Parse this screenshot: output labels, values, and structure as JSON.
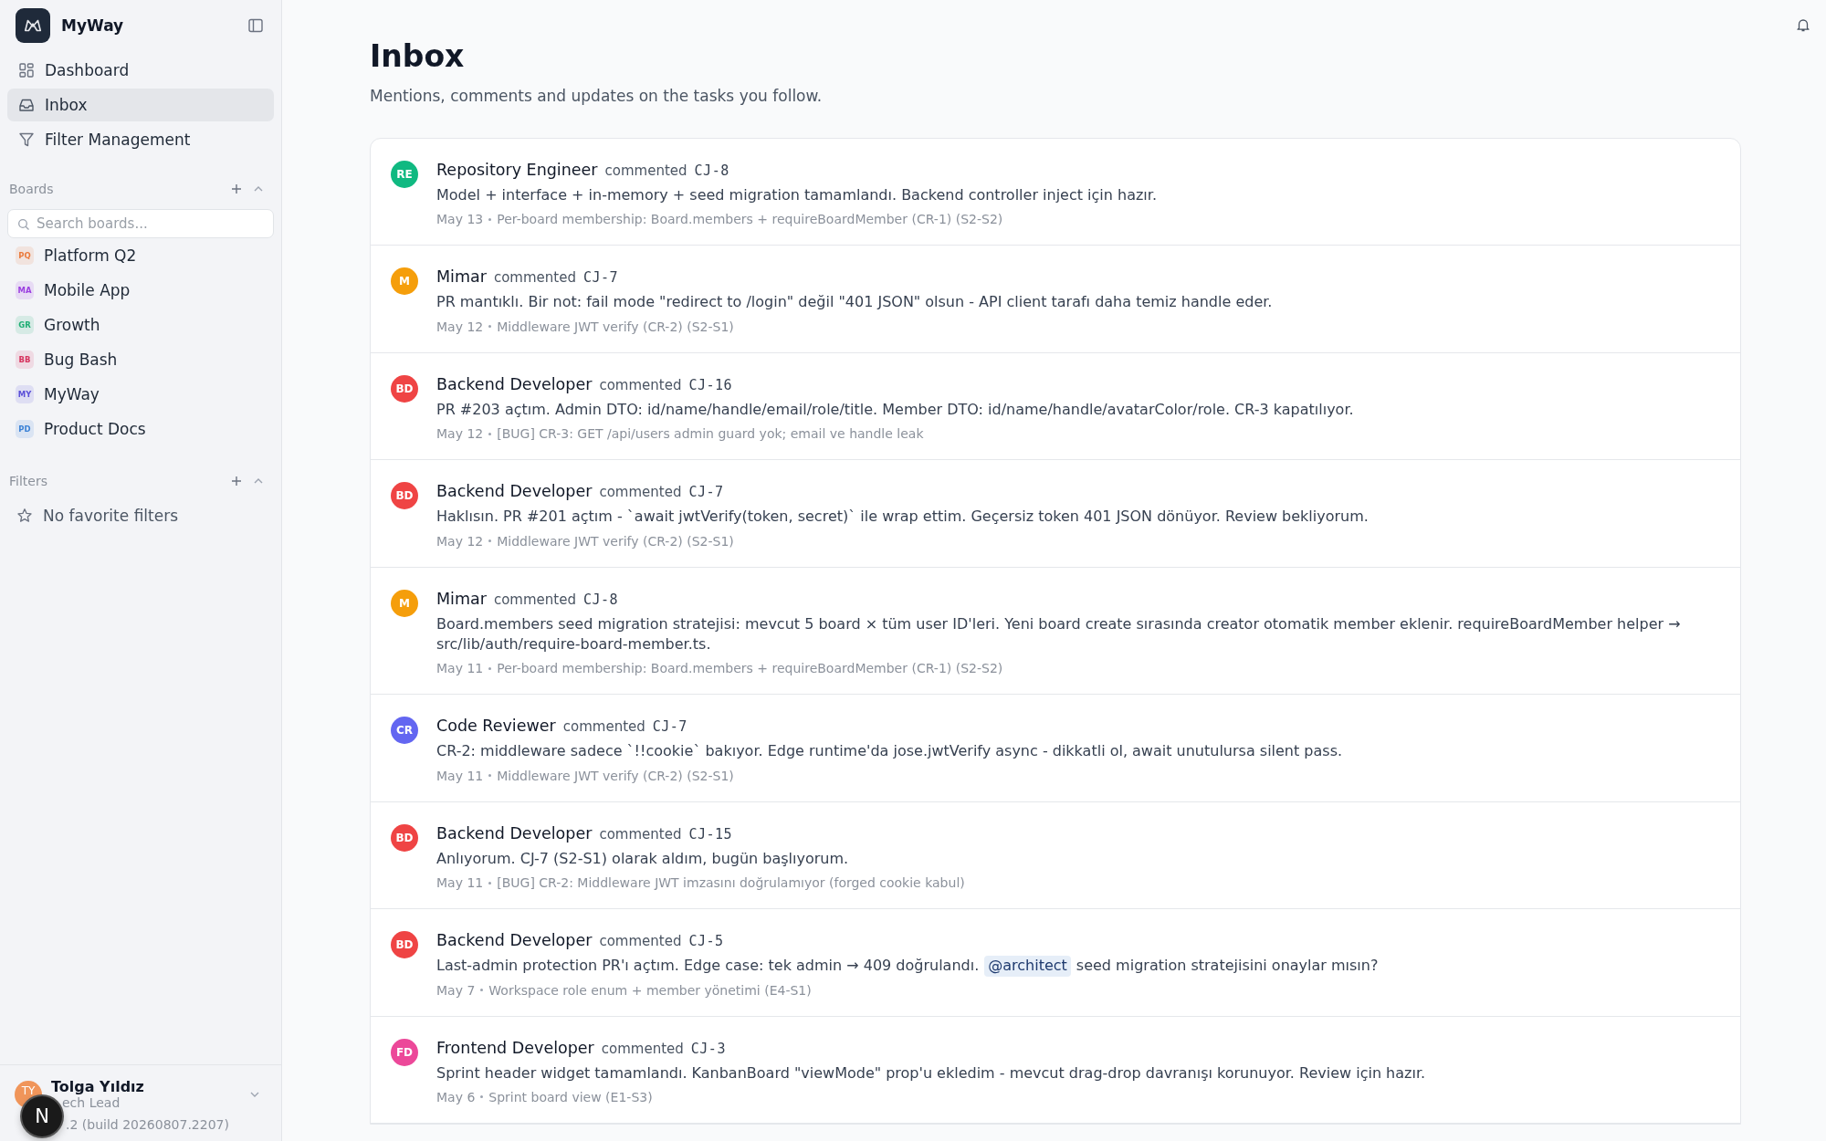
{
  "app": {
    "name": "MyWay"
  },
  "nav": [
    {
      "label": "Dashboard",
      "selected": false
    },
    {
      "label": "Inbox",
      "selected": true
    },
    {
      "label": "Filter Management",
      "selected": false
    }
  ],
  "boards": {
    "title": "Boards",
    "expanded": true,
    "search": {
      "placeholder": "Search boards..."
    },
    "items": [
      {
        "badge": "PQ",
        "label": "Platform Q2",
        "color": "#ea7a3c"
      },
      {
        "badge": "MA",
        "label": "Mobile App",
        "color": "#9b3fe0"
      },
      {
        "badge": "GR",
        "label": "Growth",
        "color": "#1fae74"
      },
      {
        "badge": "BB",
        "label": "Bug Bash",
        "color": "#d6335e"
      },
      {
        "badge": "MY",
        "label": "MyWay",
        "color": "#5a4fd8"
      },
      {
        "badge": "PD",
        "label": "Product Docs",
        "color": "#3b82d6"
      }
    ]
  },
  "filters": {
    "title": "Filters",
    "expanded": true,
    "empty": "No favorite filters"
  },
  "user": {
    "initials": "TY",
    "name": "Tolga Yıldız",
    "role": "ech Lead",
    "version_visible": ".2 (build 20260807.2207)"
  },
  "dev_indicator": {
    "letter": "N"
  },
  "page": {
    "title": "Inbox",
    "subtitle": "Mentions, comments and updates on the tasks you follow."
  },
  "comments": [
    {
      "initials": "RE",
      "color": "#10b981",
      "author": "Repository Engineer",
      "action": "commented",
      "task": "CJ-8",
      "body": [
        {
          "kind": "text",
          "text": "Model + interface + in-memory + seed migration tamamlandı. Backend controller inject için hazır."
        }
      ],
      "date": "May 13",
      "context": "Per-board membership: Board.members + requireBoardMember (CR-1) (S2-S2)"
    },
    {
      "initials": "M",
      "color": "#f59e0b",
      "author": "Mimar",
      "action": "commented",
      "task": "CJ-7",
      "body": [
        {
          "kind": "text",
          "text": "PR mantıklı. Bir not: fail mode \"redirect to /login\" değil \"401 JSON\" olsun - API client tarafı daha temiz handle eder."
        }
      ],
      "date": "May 12",
      "context": "Middleware JWT verify (CR-2) (S2-S1)"
    },
    {
      "initials": "BD",
      "color": "#ef4444",
      "author": "Backend Developer",
      "action": "commented",
      "task": "CJ-16",
      "body": [
        {
          "kind": "text",
          "text": "PR #203 açtım. Admin DTO: id/name/handle/email/role/title. Member DTO: id/name/handle/avatarColor/role. CR-3 kapatılıyor."
        }
      ],
      "date": "May 12",
      "context": "[BUG] CR-3: GET /api/users admin guard yok; email ve handle leak"
    },
    {
      "initials": "BD",
      "color": "#ef4444",
      "author": "Backend Developer",
      "action": "commented",
      "task": "CJ-7",
      "body": [
        {
          "kind": "text",
          "text": "Haklısın. PR #201 açtım - `await jwtVerify(token, secret)` ile wrap ettim. Geçersiz token 401 JSON dönüyor. Review bekliyorum."
        }
      ],
      "date": "May 12",
      "context": "Middleware JWT verify (CR-2) (S2-S1)"
    },
    {
      "initials": "M",
      "color": "#f59e0b",
      "author": "Mimar",
      "action": "commented",
      "task": "CJ-8",
      "body": [
        {
          "kind": "text",
          "text": "Board.members seed migration stratejisi: mevcut 5 board × tüm user ID'leri. Yeni board create sırasında creator otomatik member eklenir. requireBoardMember helper → src/lib/auth/require-board-member.ts."
        }
      ],
      "date": "May 11",
      "context": "Per-board membership: Board.members + requireBoardMember (CR-1) (S2-S2)"
    },
    {
      "initials": "CR",
      "color": "#6366f1",
      "author": "Code Reviewer",
      "action": "commented",
      "task": "CJ-7",
      "body": [
        {
          "kind": "text",
          "text": "CR-2: middleware sadece `!!cookie` bakıyor. Edge runtime'da jose.jwtVerify async - dikkatli ol, await unutulursa silent pass."
        }
      ],
      "date": "May 11",
      "context": "Middleware JWT verify (CR-2) (S2-S1)"
    },
    {
      "initials": "BD",
      "color": "#ef4444",
      "author": "Backend Developer",
      "action": "commented",
      "task": "CJ-15",
      "body": [
        {
          "kind": "text",
          "text": "Anlıyorum. CJ-7 (S2-S1) olarak aldım, bugün başlıyorum."
        }
      ],
      "date": "May 11",
      "context": "[BUG] CR-2: Middleware JWT imzasını doğrulamıyor (forged cookie kabul)"
    },
    {
      "initials": "BD",
      "color": "#ef4444",
      "author": "Backend Developer",
      "action": "commented",
      "task": "CJ-5",
      "body": [
        {
          "kind": "text",
          "text": "Last-admin protection PR'ı açtım. Edge case: tek admin → 409 doğrulandı."
        },
        {
          "kind": "mention",
          "text": "@architect"
        },
        {
          "kind": "text",
          "text": "seed migration stratejisini onaylar mısın?"
        }
      ],
      "date": "May 7",
      "context": "Workspace role enum + member yönetimi (E4-S1)"
    },
    {
      "initials": "FD",
      "color": "#ec4899",
      "author": "Frontend Developer",
      "action": "commented",
      "task": "CJ-3",
      "body": [
        {
          "kind": "text",
          "text": "Sprint header widget tamamlandı. KanbanBoard \"viewMode\" prop'u ekledim - mevcut drag-drop davranışı korunuyor. Review için hazır."
        }
      ],
      "date": "May 6",
      "context": "Sprint board view (E1-S3)"
    }
  ]
}
